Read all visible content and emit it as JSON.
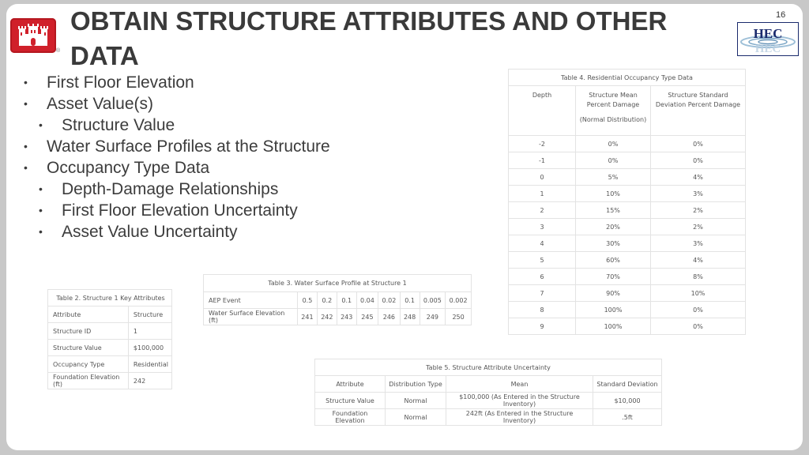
{
  "slide": {
    "title": "OBTAIN STRUCTURE ATTRIBUTES AND OTHER DATA",
    "page_number": "16",
    "registered_mark": "®",
    "logos": {
      "left": "usace-castle-logo",
      "right": "hec-logo",
      "right_text": "HEC"
    },
    "colors": {
      "frame": "#c8c8c8",
      "title": "#3a3a3a",
      "logo_red": "#d0202a",
      "hec_blue": "#1a2a6c"
    }
  },
  "bullets": [
    {
      "level": 1,
      "text": "First Floor Elevation"
    },
    {
      "level": 1,
      "text": "Asset Value(s)"
    },
    {
      "level": 2,
      "text": "Structure Value"
    },
    {
      "level": 1,
      "text": "Water Surface Profiles at the Structure"
    },
    {
      "level": 1,
      "text": "Occupancy Type Data"
    },
    {
      "level": 2,
      "text": "Depth-Damage Relationships"
    },
    {
      "level": 2,
      "text": "First Floor Elevation Uncertainty"
    },
    {
      "level": 2,
      "text": "Asset Value Uncertainty"
    }
  ],
  "table2": {
    "caption": "Table 2. Structure 1 Key Attributes",
    "headers": [
      "Attribute",
      "Structure"
    ],
    "rows": [
      [
        "Structure ID",
        "1"
      ],
      [
        "Structure Value",
        "$100,000"
      ],
      [
        "Occupancy Type",
        "Residential"
      ],
      [
        "Foundation Elevation (ft)",
        "242"
      ]
    ]
  },
  "table3": {
    "caption": "Table 3. Water Surface Profile at Structure 1",
    "rows": [
      {
        "label": "AEP Event",
        "values": [
          "0.5",
          "0.2",
          "0.1",
          "0.04",
          "0.02",
          "0.1",
          "0.005",
          "0.002"
        ]
      },
      {
        "label": "Water Surface Elevation (ft)",
        "values": [
          "241",
          "242",
          "243",
          "245",
          "246",
          "248",
          "249",
          "250"
        ]
      }
    ]
  },
  "table4": {
    "caption": "Table 4. Residential Occupancy Type Data",
    "headers": {
      "depth": "Depth",
      "mean": "Structure Mean Percent Damage",
      "mean_sub": "(Normal Distribution)",
      "std": "Structure Standard Deviation Percent Damage"
    },
    "rows": [
      [
        "-2",
        "0%",
        "0%"
      ],
      [
        "-1",
        "0%",
        "0%"
      ],
      [
        "0",
        "5%",
        "4%"
      ],
      [
        "1",
        "10%",
        "3%"
      ],
      [
        "2",
        "15%",
        "2%"
      ],
      [
        "3",
        "20%",
        "2%"
      ],
      [
        "4",
        "30%",
        "3%"
      ],
      [
        "5",
        "60%",
        "4%"
      ],
      [
        "6",
        "70%",
        "8%"
      ],
      [
        "7",
        "90%",
        "10%"
      ],
      [
        "8",
        "100%",
        "0%"
      ],
      [
        "9",
        "100%",
        "0%"
      ]
    ]
  },
  "table5": {
    "caption": "Table 5. Structure Attribute Uncertainty",
    "headers": [
      "Attribute",
      "Distribution Type",
      "Mean",
      "Standard Deviation"
    ],
    "rows": [
      [
        "Structure Value",
        "Normal",
        "$100,000 (As Entered in the Structure Inventory)",
        "$10,000"
      ],
      [
        "Foundation Elevation",
        "Normal",
        "242ft (As Entered in the Structure Inventory)",
        ".5ft"
      ]
    ]
  }
}
